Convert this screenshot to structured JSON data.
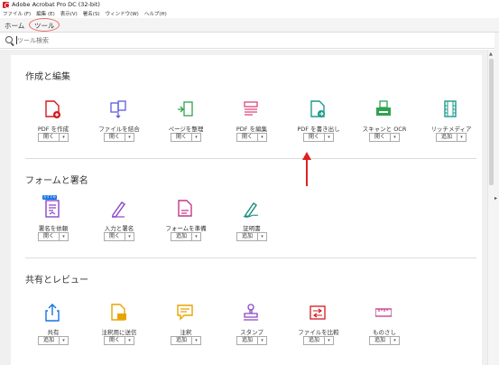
{
  "app": {
    "title": "Adobe Acrobat Pro DC (32-bit)"
  },
  "menu": [
    "ファイル (F)",
    "編集 (E)",
    "表示(V)",
    "署名(S)",
    "ウィンドウ(W)",
    "ヘルプ(H)"
  ],
  "tabs": {
    "home": "ホーム",
    "tools": "ツール"
  },
  "search": {
    "placeholder": "ツール検索"
  },
  "sections": [
    {
      "title": "作成と編集",
      "tools": [
        {
          "label": "PDF を作成",
          "button": "開く",
          "icon": "create-pdf-icon",
          "color": "#d4181f"
        },
        {
          "label": "ファイルを結合",
          "button": "開く",
          "icon": "combine-files-icon",
          "color": "#5c5ce0"
        },
        {
          "label": "ページを整理",
          "button": "開く",
          "icon": "organize-pages-icon",
          "color": "#2da44e"
        },
        {
          "label": "PDF を編集",
          "button": "開く",
          "icon": "edit-pdf-icon",
          "color": "#e0457b"
        },
        {
          "label": "PDF を書き出し",
          "button": "開く",
          "icon": "export-pdf-icon",
          "color": "#1c9a8c"
        },
        {
          "label": "スキャンと OCR",
          "button": "開く",
          "icon": "scan-ocr-icon",
          "color": "#2da44e"
        },
        {
          "label": "リッチメディア",
          "button": "追加",
          "icon": "rich-media-icon",
          "color": "#1c9a8c"
        }
      ]
    },
    {
      "title": "フォームと署名",
      "tools": [
        {
          "label": "署名を依頼",
          "button": "開く",
          "icon": "request-signature-icon",
          "color": "#8a46c8",
          "badge": "おすすめ"
        },
        {
          "label": "入力と署名",
          "button": "開く",
          "icon": "fill-sign-icon",
          "color": "#8a46c8"
        },
        {
          "label": "フォームを準備",
          "button": "追加",
          "icon": "prepare-form-icon",
          "color": "#c0398a"
        },
        {
          "label": "証明書",
          "button": "追加",
          "icon": "certificates-icon",
          "color": "#1c8f80"
        }
      ]
    },
    {
      "title": "共有とレビュー",
      "tools": [
        {
          "label": "共有",
          "button": "追加",
          "icon": "share-icon",
          "color": "#1473e6"
        },
        {
          "label": "注釈用に送信",
          "button": "開く",
          "icon": "send-for-comments-icon",
          "color": "#e6a500"
        },
        {
          "label": "注釈",
          "button": "追加",
          "icon": "comment-icon",
          "color": "#e6a500"
        },
        {
          "label": "スタンプ",
          "button": "追加",
          "icon": "stamp-icon",
          "color": "#8a46c8"
        },
        {
          "label": "ファイルを比較",
          "button": "追加",
          "icon": "compare-files-icon",
          "color": "#d4181f"
        },
        {
          "label": "ものさし",
          "button": "追加",
          "icon": "measure-icon",
          "color": "#c0398a"
        }
      ]
    }
  ]
}
